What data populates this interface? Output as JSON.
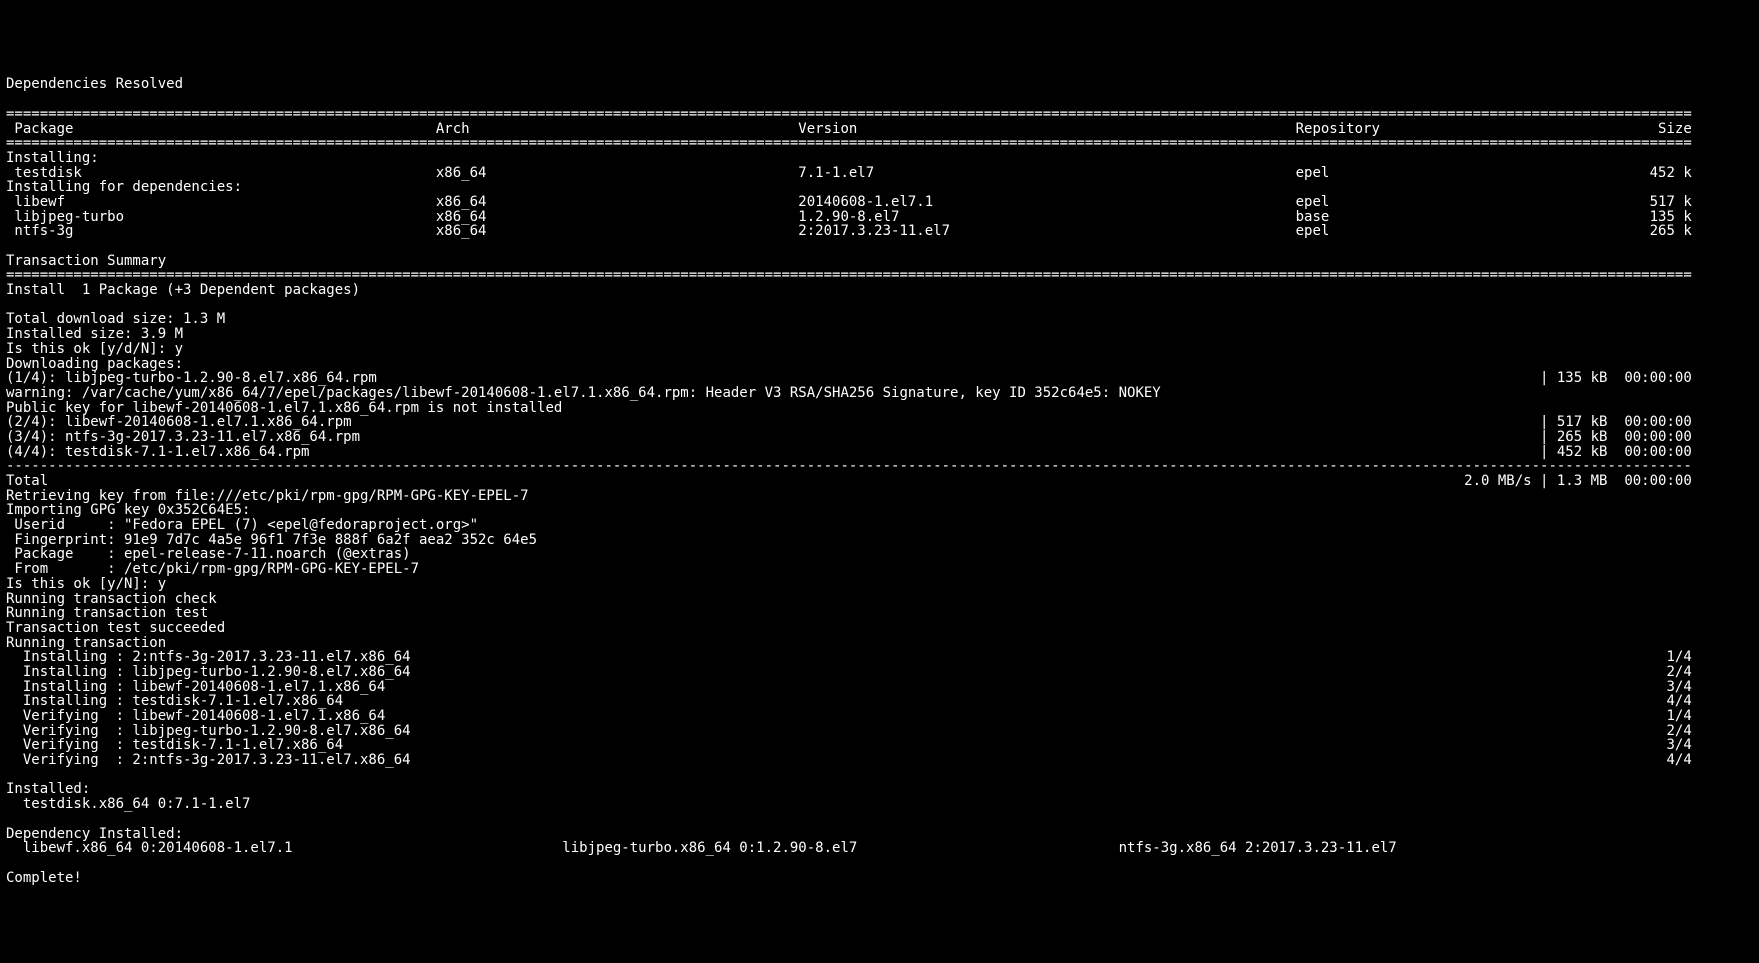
{
  "header": {
    "title": "Dependencies Resolved",
    "columns": {
      "package": "Package",
      "arch": "Arch",
      "version": "Version",
      "repository": "Repository",
      "size": "Size"
    }
  },
  "sections": {
    "installing": "Installing:",
    "installing_deps": "Installing for dependencies:",
    "transaction_summary": "Transaction Summary"
  },
  "packages_main": [
    {
      "name": "testdisk",
      "arch": "x86_64",
      "version": "7.1-1.el7",
      "repo": "epel",
      "size": "452 k"
    }
  ],
  "packages_deps": [
    {
      "name": "libewf",
      "arch": "x86_64",
      "version": "20140608-1.el7.1",
      "repo": "epel",
      "size": "517 k"
    },
    {
      "name": "libjpeg-turbo",
      "arch": "x86_64",
      "version": "1.2.90-8.el7",
      "repo": "base",
      "size": "135 k"
    },
    {
      "name": "ntfs-3g",
      "arch": "x86_64",
      "version": "2:2017.3.23-11.el7",
      "repo": "epel",
      "size": "265 k"
    }
  ],
  "summary": {
    "install_line": "Install  1 Package (+3 Dependent packages)",
    "total_dl": "Total download size: 1.3 M",
    "installed": "Installed size: 3.9 M",
    "prompt1": "Is this ok [y/d/N]: y",
    "downloading": "Downloading packages:"
  },
  "downloads": {
    "d1": {
      "left": "(1/4): libjpeg-turbo-1.2.90-8.el7.x86_64.rpm",
      "right": "| 135 kB  00:00:00"
    },
    "warn": "warning: /var/cache/yum/x86_64/7/epel/packages/libewf-20140608-1.el7.1.x86_64.rpm: Header V3 RSA/SHA256 Signature, key ID 352c64e5: NOKEY",
    "pubkey": "Public key for libewf-20140608-1.el7.1.x86_64.rpm is not installed",
    "d2": {
      "left": "(2/4): libewf-20140608-1.el7.1.x86_64.rpm",
      "right": "| 517 kB  00:00:00"
    },
    "d3": {
      "left": "(3/4): ntfs-3g-2017.3.23-11.el7.x86_64.rpm",
      "right": "| 265 kB  00:00:00"
    },
    "d4": {
      "left": "(4/4): testdisk-7.1-1.el7.x86_64.rpm",
      "right": "| 452 kB  00:00:00"
    },
    "total": {
      "left": "Total",
      "right": "2.0 MB/s | 1.3 MB  00:00:00"
    }
  },
  "gpg": {
    "retrieve": "Retrieving key from file:///etc/pki/rpm-gpg/RPM-GPG-KEY-EPEL-7",
    "importing": "Importing GPG key 0x352C64E5:",
    "userid": " Userid     : \"Fedora EPEL (7) <epel@fedoraproject.org>\"",
    "fingerprint": " Fingerprint: 91e9 7d7c 4a5e 96f1 7f3e 888f 6a2f aea2 352c 64e5",
    "package": " Package    : epel-release-7-11.noarch (@extras)",
    "from": " From       : /etc/pki/rpm-gpg/RPM-GPG-KEY-EPEL-7",
    "prompt2": "Is this ok [y/N]: y"
  },
  "trans": {
    "check": "Running transaction check",
    "test": "Running transaction test",
    "succeed": "Transaction test succeeded",
    "run": "Running transaction"
  },
  "steps": [
    {
      "left": "  Installing : 2:ntfs-3g-2017.3.23-11.el7.x86_64",
      "right": "1/4"
    },
    {
      "left": "  Installing : libjpeg-turbo-1.2.90-8.el7.x86_64",
      "right": "2/4"
    },
    {
      "left": "  Installing : libewf-20140608-1.el7.1.x86_64",
      "right": "3/4"
    },
    {
      "left": "  Installing : testdisk-7.1-1.el7.x86_64",
      "right": "4/4"
    },
    {
      "left": "  Verifying  : libewf-20140608-1.el7.1.x86_64",
      "right": "1/4"
    },
    {
      "left": "  Verifying  : libjpeg-turbo-1.2.90-8.el7.x86_64",
      "right": "2/4"
    },
    {
      "left": "  Verifying  : testdisk-7.1-1.el7.x86_64",
      "right": "3/4"
    },
    {
      "left": "  Verifying  : 2:ntfs-3g-2017.3.23-11.el7.x86_64",
      "right": "4/4"
    }
  ],
  "installed_list": {
    "header": "Installed:",
    "line": "  testdisk.x86_64 0:7.1-1.el7"
  },
  "dep_installed": {
    "header": "Dependency Installed:",
    "a": "libewf.x86_64 0:20140608-1.el7.1",
    "b": "libjpeg-turbo.x86_64 0:1.2.90-8.el7",
    "c": "ntfs-3g.x86_64 2:2017.3.23-11.el7"
  },
  "complete": "Complete!",
  "geom": {
    "cols": 200,
    "col_pkg": 0,
    "col_arch": 51,
    "col_ver": 94,
    "col_repo": 153,
    "col_size_end": 200,
    "right_col_start": 173,
    "dep_b": 66,
    "dep_c": 132
  }
}
